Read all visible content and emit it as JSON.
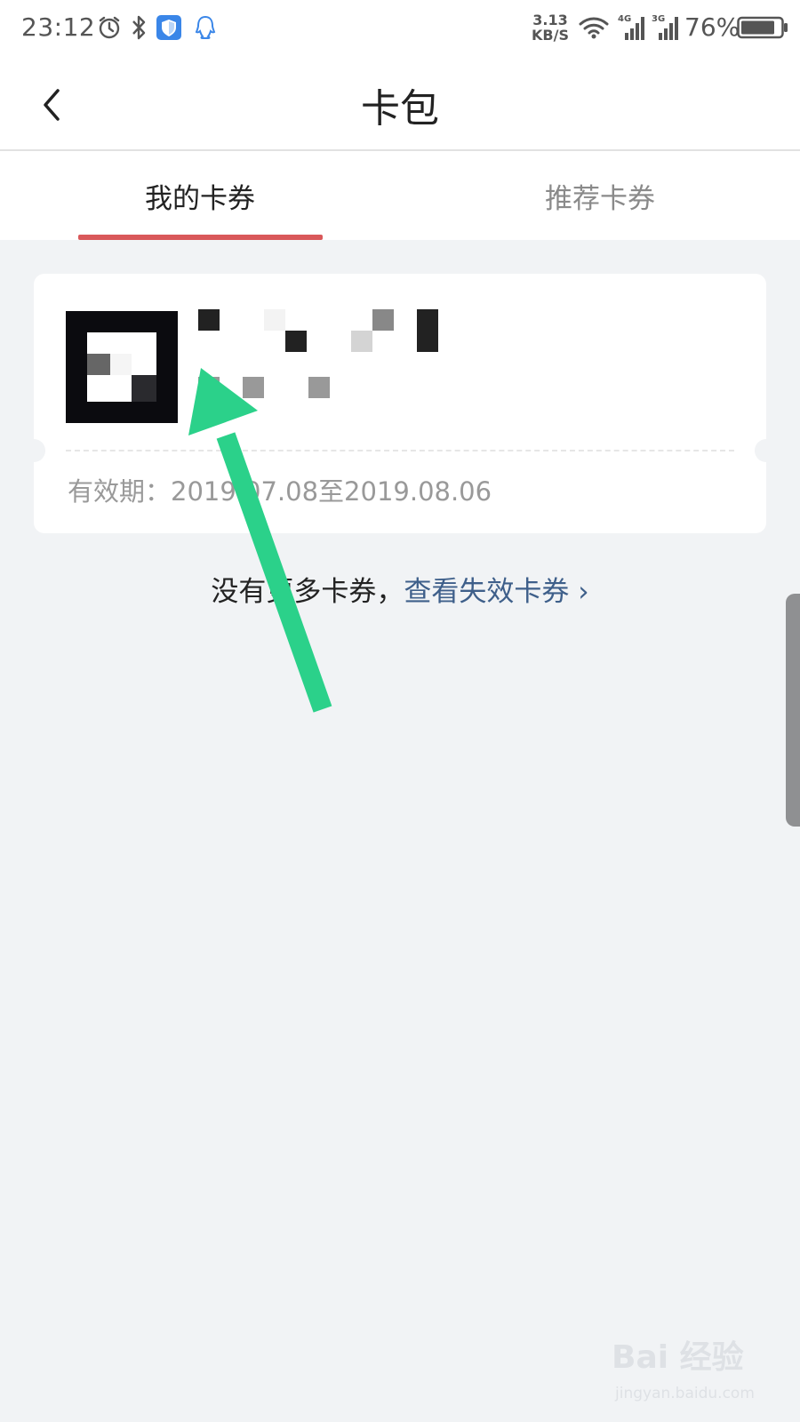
{
  "status_bar": {
    "time": "23:12",
    "speed": "3.13",
    "speed_unit": "KB/S",
    "net1": "4G",
    "net2": "3G",
    "battery": "76%"
  },
  "navbar": {
    "title": "卡包"
  },
  "tabs": [
    {
      "label": "我的卡券",
      "active": true
    },
    {
      "label": "推荐卡券",
      "active": false
    }
  ],
  "coupon": {
    "validity": "有效期：2019.07.08至2019.08.06"
  },
  "footer": {
    "text": "没有更多卡券，",
    "link": "查看失效卡券",
    "chevron": "›"
  },
  "watermark": {
    "logo": "Bai 经验",
    "sub": "jingyan.baidu.com"
  },
  "colors": {
    "accent_red": "#d9585a",
    "link_blue": "#3e5f8a",
    "annotation_green": "#2bd18a"
  },
  "icons": [
    "alarm-icon",
    "bluetooth-icon",
    "shield-icon",
    "qq-icon",
    "wifi-icon",
    "signal-icon",
    "battery-icon",
    "back-chevron-icon"
  ]
}
